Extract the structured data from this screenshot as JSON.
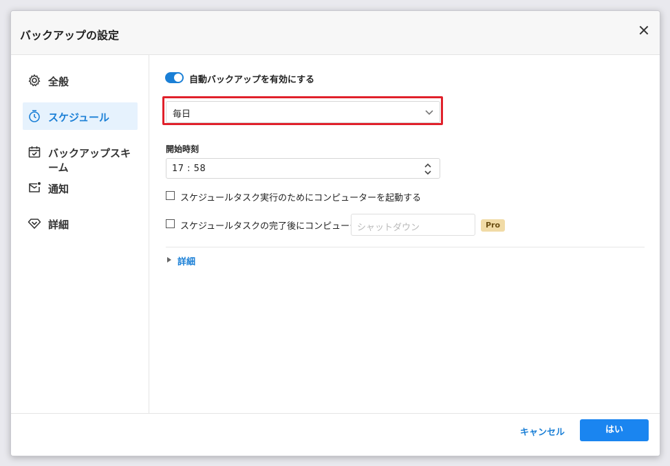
{
  "dialog": {
    "title": "バックアップの設定",
    "close_icon": "close-icon"
  },
  "sidebar": {
    "items": [
      {
        "label": "全般",
        "icon": "gear-icon"
      },
      {
        "label": "スケジュール",
        "icon": "timer-icon",
        "active": true
      },
      {
        "label": "バックアップスキーム",
        "icon": "calendar-check-icon"
      },
      {
        "label": "通知",
        "icon": "mail-icon"
      },
      {
        "label": "詳細",
        "icon": "diamond-icon"
      }
    ]
  },
  "schedule": {
    "auto_backup_label": "自動バックアップを有効にする",
    "auto_backup_enabled": true,
    "frequency_value": "毎日",
    "start_time_label": "開始時刻",
    "start_time_value": "17 : 58",
    "wake_checkbox_label": "スケジュールタスク実行のためにコンピューターを起動する",
    "wake_checked": false,
    "after_checkbox_label": "スケジュールタスクの完了後にコンピューターを",
    "after_checked": false,
    "after_action_placeholder": "シャットダウン",
    "pro_badge": "Pro",
    "details_label": "詳細"
  },
  "footer": {
    "cancel_label": "キャンセル",
    "ok_label": "はい"
  },
  "colors": {
    "accent": "#1a7fd6",
    "highlight_border": "#e0202a",
    "pro_badge_bg": "#f1dba6"
  }
}
